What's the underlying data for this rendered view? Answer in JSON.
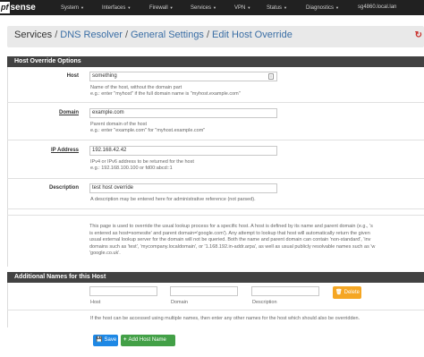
{
  "navbar": {
    "logo_box": "pf",
    "logo_text": "sense",
    "items": [
      {
        "label": "System"
      },
      {
        "label": "Interfaces"
      },
      {
        "label": "Firewall"
      },
      {
        "label": "Services"
      },
      {
        "label": "VPN"
      },
      {
        "label": "Status"
      },
      {
        "label": "Diagnostics"
      },
      {
        "label": "sg4860.local.lan"
      }
    ]
  },
  "breadcrumb": {
    "items": [
      "Services",
      "DNS Resolver",
      "General Settings",
      "Edit Host Override"
    ]
  },
  "host_override_panel": {
    "title": "Host Override Options",
    "host": {
      "label": "Host",
      "value": "something",
      "help1": "Name of the host, without the domain part",
      "help2": "e.g.: enter \"myhost\" if the full domain name is \"myhost.example.com\""
    },
    "domain": {
      "label": "Domain",
      "value": "example.com",
      "help1": "Parent domain of the host",
      "help2": "e.g.: enter \"example.com\" for \"myhost.example.com\""
    },
    "ip_address": {
      "label": "IP Address",
      "value": "192.168.42.42",
      "help1": "IPv4 or IPv6 address to be returned for the host",
      "help2": "e.g.: 192.168.100.100 or fd00:abcd::1"
    },
    "description": {
      "label": "Description",
      "value": "test host override",
      "help1": "A description may be entered here for administrative reference (not parsed)."
    },
    "info_lines": [
      "This page is used to override the usual lookup process for a specific host. A host is defined by its name and parent domain (e.g., 's",
      "is entered as host=somesite' and parent domain='google.com'). Any attempt to lookup that host will automatically return the given",
      "usual external lookup server for the domain will not be queried. Both the name and parent domain can contain 'non-standard', 'inv",
      "domains such as 'test', 'mycompany.localdomain', or '1.168.192.in-addr.arpa', as well as usual publicly resolvable names such as 'w",
      "'google.co.uk'."
    ]
  },
  "additional_panel": {
    "title": "Additional Names for this Host",
    "col_host": "Host",
    "col_domain": "Domain",
    "col_description": "Description",
    "delete_label": "Delete",
    "help": "If the host can be accessed using multiple names, then enter any other names for the host which should also be overridden."
  },
  "buttons": {
    "save": "Save",
    "add_host_name": "Add Host Name"
  }
}
